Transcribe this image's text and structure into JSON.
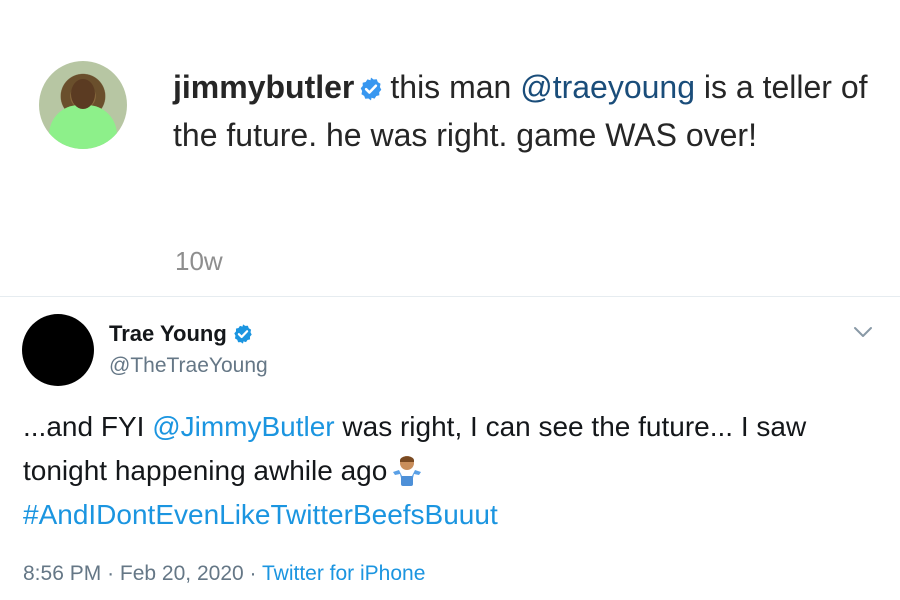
{
  "instagram_comment": {
    "username": "jimmybutler",
    "text_before_mention": "this man",
    "mention": "@traeyoung",
    "text_after_mention": "is a teller of the future. he was right. game WAS over!",
    "timestamp": "10w"
  },
  "tweet": {
    "display_name": "Trae Young",
    "handle": "@TheTraeYoung",
    "body_before_mention": "...and FYI",
    "mention": "@JimmyButler",
    "body_after_mention": "was right, I can see the future... I saw tonight happening awhile ago",
    "hashtag": "#AndIDontEvenLikeTwitterBeefsBuuut",
    "time": "8:56 PM",
    "date": "Feb 20, 2020",
    "separator": "·",
    "source": "Twitter for iPhone"
  },
  "colors": {
    "twitter_blue": "#1b95e0",
    "instagram_verified": "#3897f0",
    "instagram_mention": "#1a4d7a"
  },
  "icons": {
    "ig_verified": "verified-badge-icon",
    "tw_verified": "verified-badge-icon",
    "menu": "chevron-down-icon",
    "emoji": "person-shrugging-emoji"
  }
}
